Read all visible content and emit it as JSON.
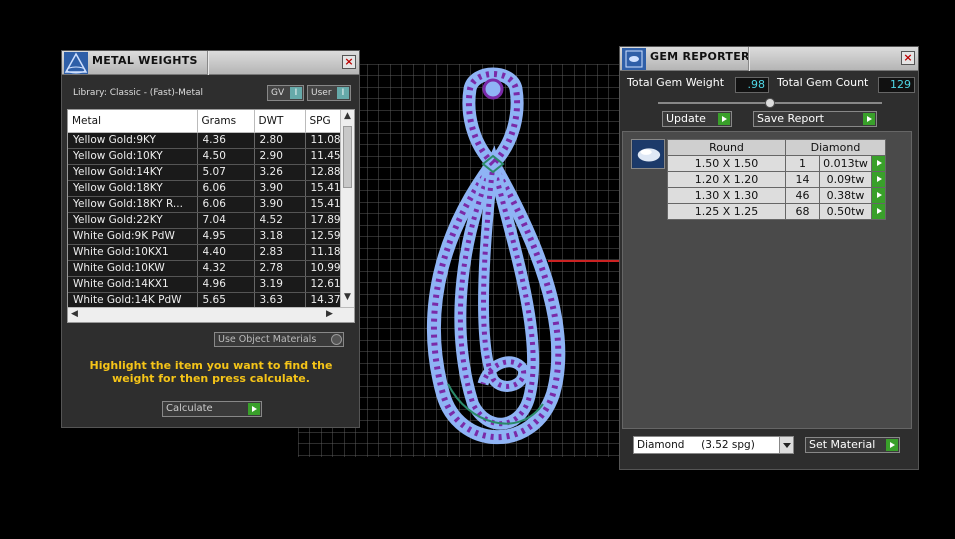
{
  "metal_weights": {
    "title": "METAL WEIGHTS",
    "close": "×",
    "library": "Library: Classic - (Fast)-Metal",
    "toggle_gv": "GV",
    "toggle_user": "User",
    "toggle_mark": "I",
    "columns": [
      "Metal",
      "Grams",
      "DWT",
      "SPG"
    ],
    "rows": [
      [
        "Yellow Gold:9KY",
        "4.36",
        "2.80",
        "11.08"
      ],
      [
        "Yellow Gold:10KY",
        "4.50",
        "2.90",
        "11.45"
      ],
      [
        "Yellow Gold:14KY",
        "5.07",
        "3.26",
        "12.88"
      ],
      [
        "Yellow Gold:18KY",
        "6.06",
        "3.90",
        "15.41"
      ],
      [
        "Yellow Gold:18KY R...",
        "6.06",
        "3.90",
        "15.41"
      ],
      [
        "Yellow Gold:22KY",
        "7.04",
        "4.52",
        "17.89"
      ],
      [
        "White Gold:9K PdW",
        "4.95",
        "3.18",
        "12.59"
      ],
      [
        "White Gold:10KX1",
        "4.40",
        "2.83",
        "11.18"
      ],
      [
        "White Gold:10KW",
        "4.32",
        "2.78",
        "10.99"
      ],
      [
        "White Gold:14KX1",
        "4.96",
        "3.19",
        "12.61"
      ],
      [
        "White Gold:14K PdW",
        "5.65",
        "3.63",
        "14.37"
      ]
    ],
    "use_object_materials": "Use Object Materials",
    "hint": "Highlight the item you want to find the weight for then press calculate.",
    "calculate": "Calculate"
  },
  "gem_reporter": {
    "title": "GEM REPORTER",
    "close": "×",
    "total_weight_label": "Total Gem Weight",
    "total_weight_value": ".98",
    "total_count_label": "Total Gem Count",
    "total_count_value": "129",
    "update": "Update",
    "save_report": "Save Report",
    "table_headers": [
      "Round",
      "Diamond"
    ],
    "rows": [
      {
        "size": "1.50 X 1.50",
        "count": "1",
        "weight": "0.013tw"
      },
      {
        "size": "1.20 X 1.20",
        "count": "14",
        "weight": "0.09tw"
      },
      {
        "size": "1.30 X 1.30",
        "count": "46",
        "weight": "0.38tw"
      },
      {
        "size": "1.25 X 1.25",
        "count": "68",
        "weight": "0.50tw"
      }
    ],
    "material_select": "Diamond     (3.52 spg)",
    "set_material": "Set Material"
  },
  "colors": {
    "gem_fill": "#8fb4f5",
    "gem_dots": "#7a2aa8",
    "wire": "#2a8a6a",
    "hint": "#f5c418"
  }
}
